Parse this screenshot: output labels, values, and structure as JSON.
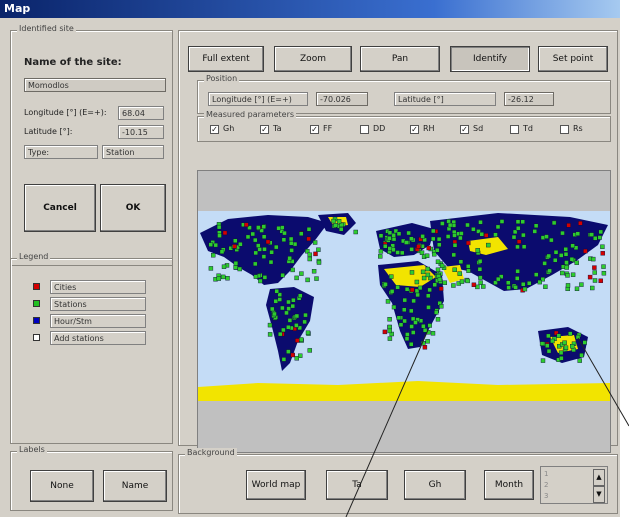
{
  "window": {
    "title": "Map"
  },
  "identified_site": {
    "group_label": "Identified site",
    "name_label": "Name of the site:",
    "name_value": "Momodlos",
    "longitude_label": "Longitude [°] (E=+):",
    "longitude_value": "68.04",
    "latitude_label": "Latitude [°]:",
    "latitude_value": "-10.15",
    "type_label": "Type:",
    "type_value": "Station",
    "cancel_label": "Cancel",
    "ok_label": "OK"
  },
  "legend": {
    "group_label": "Legend",
    "items": [
      {
        "label": "Cities",
        "color": "#d40000"
      },
      {
        "label": "Stations",
        "color": "#22c022"
      },
      {
        "label": "Hour/Stm",
        "color": "#0000c0"
      },
      {
        "label": "Add stations",
        "color": "#ffffff"
      }
    ]
  },
  "labels": {
    "group_label": "Labels",
    "none_label": "None",
    "name_label": "Name"
  },
  "toolbar": {
    "buttons": [
      "Full extent",
      "Zoom",
      "Pan",
      "Identify",
      "Set point"
    ],
    "active": "Identify"
  },
  "position": {
    "group_label": "Position",
    "longitude_label": "Longitude [°] (E=+)",
    "longitude_value": "-70.026",
    "latitude_label": "Latitude [°]",
    "latitude_value": "-26.12"
  },
  "measured_parameters": {
    "group_label": "Measured parameters",
    "items": [
      {
        "label": "Gh",
        "checked": true
      },
      {
        "label": "Ta",
        "checked": true
      },
      {
        "label": "FF",
        "checked": true
      },
      {
        "label": "DD",
        "checked": false
      },
      {
        "label": "RH",
        "checked": true
      },
      {
        "label": "Sd",
        "checked": true
      },
      {
        "label": "Td",
        "checked": false
      },
      {
        "label": "Rs",
        "checked": false
      }
    ]
  },
  "background": {
    "group_label": "Background",
    "world_map_label": "World map",
    "ta_label": "Ta",
    "gh_label": "Gh",
    "month_label": "Month",
    "month_options": [
      "1",
      "2",
      "3"
    ]
  },
  "colors": {
    "ocean": "#c4dcf6",
    "land": "#0b0b6e",
    "desert": "#f2e400",
    "ice": "#f2e400",
    "station": "#2ecc2e",
    "city": "#d40000"
  }
}
